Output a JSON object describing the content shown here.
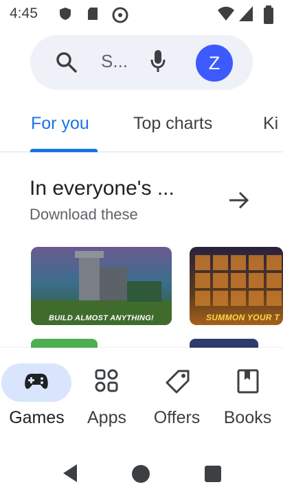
{
  "status_bar": {
    "time": "4:45"
  },
  "search": {
    "placeholder": "S..."
  },
  "account": {
    "initial": "Z"
  },
  "tabs": [
    {
      "label": "For you",
      "active": true
    },
    {
      "label": "Top charts",
      "active": false
    },
    {
      "label": "Ki",
      "active": false
    }
  ],
  "section": {
    "title": "In everyone's ...",
    "subtitle": "Download these"
  },
  "cards": [
    {
      "caption": "BUILD ALMOST ANYTHING!"
    },
    {
      "caption": "SUMMON YOUR T"
    }
  ],
  "bottom_nav": [
    {
      "label": "Games",
      "icon": "gamepad-icon",
      "active": true
    },
    {
      "label": "Apps",
      "icon": "apps-grid-icon",
      "active": false
    },
    {
      "label": "Offers",
      "icon": "tag-icon",
      "active": false
    },
    {
      "label": "Books",
      "icon": "book-icon",
      "active": false
    }
  ],
  "colors": {
    "accent": "#1a73e8",
    "avatar": "#3d5afe",
    "active_pill": "#d8e5fd"
  }
}
